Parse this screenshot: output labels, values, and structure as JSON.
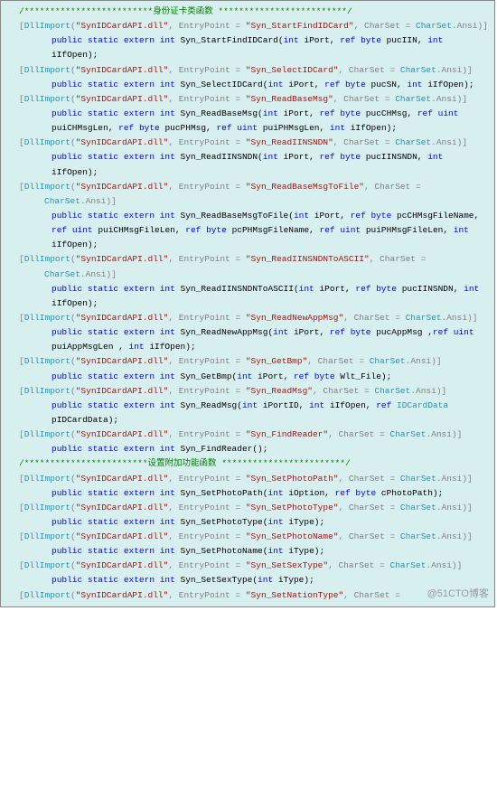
{
  "watermark": "@51CTO博客",
  "header1": "/*************************身份证卡类函数 *************************/",
  "header2": "/************************设置附加功能函数 ************************/",
  "dll": "\"SynIDCardAPI.dll\"",
  "ep": {
    "StartFind": "\"Syn_StartFindIDCard\"",
    "SelectID": "\"Syn_SelectIDCard\"",
    "ReadBaseMsg": "\"Syn_ReadBaseMsg\"",
    "ReadIINSNDN": "\"Syn_ReadIINSNDN\"",
    "ReadBaseMsgToFile": "\"Syn_ReadBaseMsgToFile\"",
    "ReadIINSNDNToASCII": "\"Syn_ReadIINSNDNToASCII\"",
    "ReadNewAppMsg": "\"Syn_ReadNewAppMsg\"",
    "GetBmp": "\"Syn_GetBmp\"",
    "ReadMsg": "\"Syn_ReadMsg\"",
    "FindReader": "\"Syn_FindReader\"",
    "SetPhotoPath": "\"Syn_SetPhotoPath\"",
    "SetPhotoType": "\"Syn_SetPhotoType\"",
    "SetPhotoName": "\"Syn_SetPhotoName\"",
    "SetSexType": "\"Syn_SetSexType\"",
    "SetNationType": "\"Syn_SetNationType\""
  },
  "txt": {
    "DllImport": "DllImport",
    "EntryPoint": ", EntryPoint = ",
    "CharSetEq": ", CharSet = ",
    "CharSet": "CharSet",
    "AnsiClose": ".Ansi)]",
    "publicStaticExternInt": "public static extern int",
    "int": "int",
    "ref": "ref",
    "byte": "byte",
    "uint": "uint",
    "IDCardData": "IDCardData"
  },
  "sig": {
    "StartFind": " Syn_StartFindIDCard(",
    "StartFindParams": " iPort, ",
    "StartFindP2": " pucIIN, ",
    "StartFindEnd": " iIfOpen);",
    "SelectID": " Syn_SelectIDCard(",
    "SelectIDP2": " pucSN, ",
    "ReadBaseMsg": " Syn_ReadBaseMsg(",
    "ReadBaseMsgP2": " pucCHMsg, ",
    "ReadBaseMsgP3": " puiCHMsgLen, ",
    "ReadBaseMsgP4": " pucPHMsg, ",
    "ReadBaseMsgP5": " puiPHMsgLen, ",
    "ReadIINSNDN": " Syn_ReadIINSNDN(",
    "ReadIINSNDNP2": " pucIINSNDN, ",
    "ReadBaseMsgToFile": " Syn_ReadBaseMsgToFile(",
    "ReadBaseMsgToFileP2": " pcCHMsgFileName, ",
    "ReadBaseMsgToFileP3": " puiCHMsgFileLen, ",
    "ReadBaseMsgToFileP4": " pcPHMsgFileName, ",
    "ReadBaseMsgToFileP5": " puiPHMsgFileLen, ",
    "ReadIINSNDNToASCII": " Syn_ReadIINSNDNToASCII(",
    "ReadNewAppMsg": " Syn_ReadNewAppMsg(",
    "ReadNewAppMsgP2": "  pucAppMsg ,",
    "ReadNewAppMsgP3": " puiAppMsgLen , ",
    "GetBmp": " Syn_GetBmp(",
    "GetBmpP2": " Wlt_File);",
    "ReadMsg": " Syn_ReadMsg(",
    "ReadMsgP1": " iPortID, ",
    "ReadMsgP2": " iIfOpen, ",
    "ReadMsgEnd": " pIDCardData);",
    "FindReader": " Syn_FindReader();",
    "SetPhotoPath": " Syn_SetPhotoPath(",
    "SetPhotoPathP1": " iOption, ",
    "SetPhotoPathP2": " cPhotoPath);",
    "SetPhotoType": " Syn_SetPhotoType(",
    "SetPhotoTypeP": " iType);",
    "SetPhotoName": " Syn_SetPhotoName(",
    "SetSexType": " Syn_SetSexType("
  }
}
